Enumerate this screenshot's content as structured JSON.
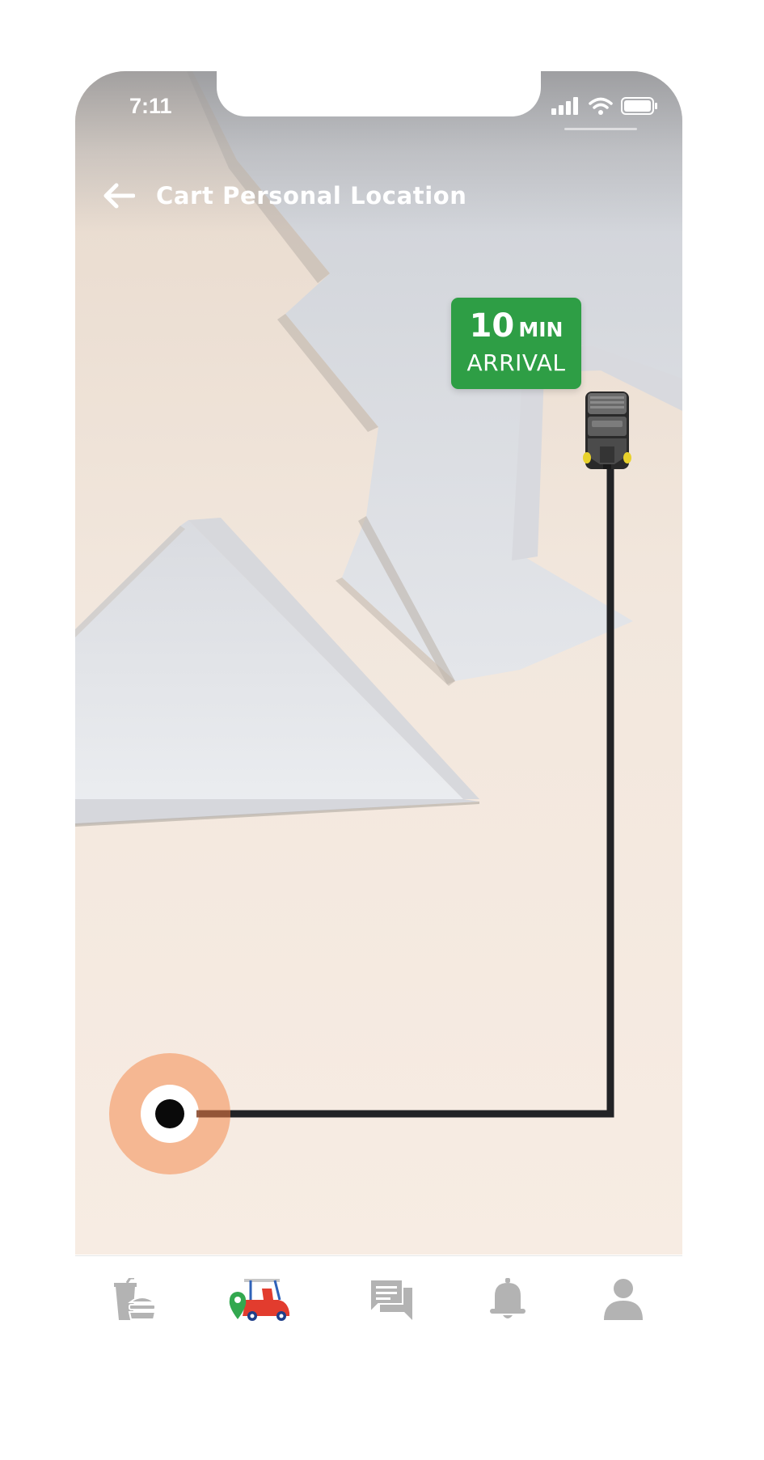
{
  "status_bar": {
    "time": "7:11",
    "icons": [
      "signal-icon",
      "wifi-icon",
      "battery-icon"
    ]
  },
  "header": {
    "back_icon": "back-arrow-icon",
    "title": "Cart Personal Location"
  },
  "eta": {
    "value": "10",
    "unit": "MIN",
    "label": "ARRIVAL",
    "color": "#2e9e45"
  },
  "map": {
    "route_color": "#222326",
    "user_marker_color": "#f5b792"
  },
  "tabbar": {
    "items": [
      {
        "name": "food-order",
        "icon": "food-drink-icon",
        "active": false
      },
      {
        "name": "cart-location",
        "icon": "cart-location-icon",
        "active": true
      },
      {
        "name": "messages",
        "icon": "chat-icon",
        "active": false
      },
      {
        "name": "notifications",
        "icon": "bell-icon",
        "active": false
      },
      {
        "name": "profile",
        "icon": "user-icon",
        "active": false
      }
    ],
    "inactive_color": "#b3b3b3"
  }
}
